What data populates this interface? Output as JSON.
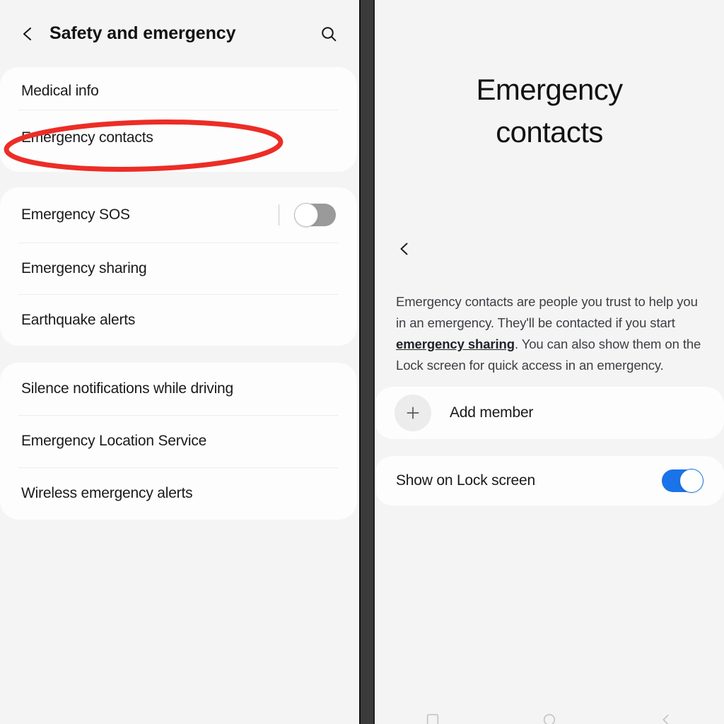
{
  "colors": {
    "page_background": "#f4f4f4",
    "card_background": "#fdfdfd",
    "divider_bar": "#3b3b3b",
    "annotation_red": "#ec2d26",
    "toggle_on_blue": "#1a73e8",
    "toggle_off_gray": "#9a9a9a",
    "primary_text": "#1a1a1a",
    "secondary_text": "#3c3f43"
  },
  "left_panel": {
    "header": {
      "back_label": "Back",
      "title": "Safety and emergency",
      "search_label": "Search"
    },
    "groups": [
      {
        "name": "medical-group",
        "rows": [
          {
            "label": "Medical info",
            "control": "none"
          },
          {
            "label": "Emergency contacts",
            "control": "none",
            "highlighted": true
          }
        ]
      },
      {
        "name": "emergency-group",
        "rows": [
          {
            "label": "Emergency SOS",
            "control": "switch",
            "switch_state": "off"
          },
          {
            "label": "Emergency sharing",
            "control": "none"
          },
          {
            "label": "Earthquake alerts",
            "control": "none"
          }
        ]
      },
      {
        "name": "other-group",
        "rows": [
          {
            "label": "Silence notifications while driving",
            "control": "none"
          },
          {
            "label": "Emergency Location Service",
            "control": "none"
          },
          {
            "label": "Wireless emergency alerts",
            "control": "none"
          }
        ]
      }
    ],
    "annotation": {
      "shape": "ellipse",
      "target_row": "Emergency contacts",
      "color": "#ec2d26"
    }
  },
  "right_panel": {
    "title_line_1": "Emergency",
    "title_line_2": "contacts",
    "back_label": "Back",
    "description": {
      "part_1": "Emergency contacts are people you trust to help you in an emergency. They'll be contacted if you start ",
      "link_text": "emergency sharing",
      "part_2": ". You can also show them on the Lock screen for quick access in an emergency."
    },
    "add_member": {
      "label": "Add member",
      "icon": "plus-icon"
    },
    "lock_screen": {
      "label": "Show on Lock screen",
      "switch_state": "on"
    },
    "navbar": {
      "recents_label": "Recents",
      "home_label": "Home",
      "back_label": "Back"
    }
  }
}
